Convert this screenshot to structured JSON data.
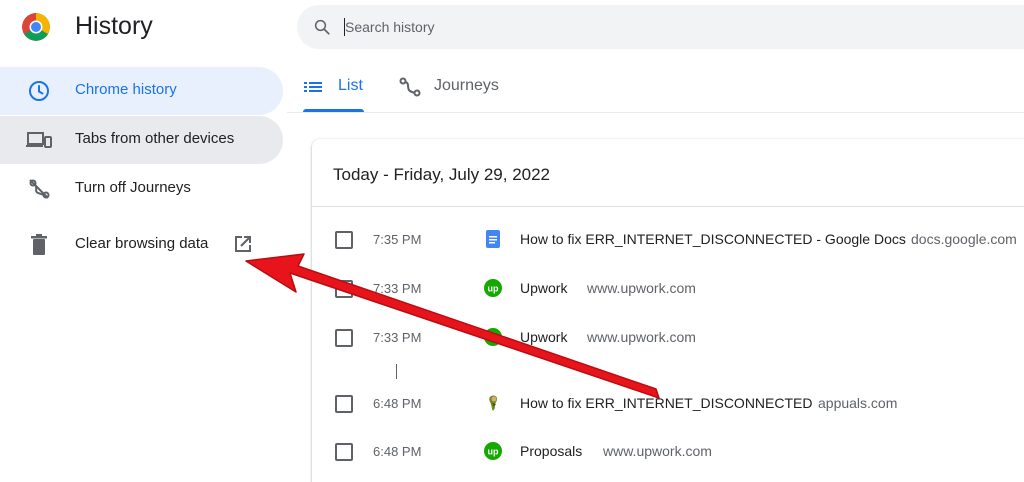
{
  "app": {
    "title": "History"
  },
  "search": {
    "placeholder": "Search history",
    "value": ""
  },
  "sidebar": {
    "items": [
      {
        "label": "Chrome history",
        "icon": "clock-icon",
        "state": "active"
      },
      {
        "label": "Tabs from other devices",
        "icon": "devices-icon",
        "state": "hover"
      },
      {
        "label": "Turn off Journeys",
        "icon": "journeys-off-icon",
        "state": "normal"
      },
      {
        "label": "Clear browsing data",
        "icon": "trash-icon",
        "state": "normal",
        "trailing_icon": "open-in-new-icon"
      }
    ]
  },
  "tabs": [
    {
      "label": "List",
      "icon": "list-icon",
      "selected": true
    },
    {
      "label": "Journeys",
      "icon": "journeys-icon",
      "selected": false
    }
  ],
  "history": {
    "date_header": "Today - Friday, July 29, 2022",
    "entries": [
      {
        "time": "7:35 PM",
        "title": "How to fix ERR_INTERNET_DISCONNECTED - Google Docs",
        "domain": "docs.google.com",
        "favicon": "google-docs-icon"
      },
      {
        "time": "7:33 PM",
        "title": "Upwork",
        "domain": "www.upwork.com",
        "favicon": "upwork-icon"
      },
      {
        "time": "7:33 PM",
        "title": "Upwork",
        "domain": "www.upwork.com",
        "favicon": "upwork-icon"
      },
      {
        "time": "6:48 PM",
        "title": "How to fix ERR_INTERNET_DISCONNECTED",
        "domain": "appuals.com",
        "favicon": "appuals-icon"
      },
      {
        "time": "6:48 PM",
        "title": "Proposals",
        "domain": "www.upwork.com",
        "favicon": "upwork-icon"
      }
    ]
  },
  "colors": {
    "accent": "#1a73e8",
    "active_background": "#e8f0fe",
    "hover_background": "#e8eaed",
    "upwork_green": "#14a800",
    "annotation_red": "#e8141b"
  }
}
